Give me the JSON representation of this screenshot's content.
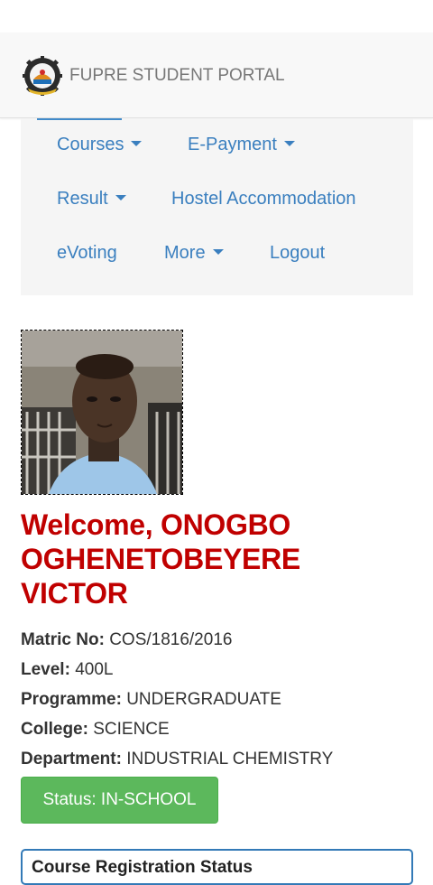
{
  "brand": {
    "title": "FUPRE STUDENT PORTAL",
    "logo_icon": "university-crest-icon"
  },
  "menu": {
    "items": [
      {
        "label": "Courses",
        "has_dropdown": true
      },
      {
        "label": "E-Payment",
        "has_dropdown": true
      },
      {
        "label": "Result",
        "has_dropdown": true
      },
      {
        "label": "Hostel Accommodation",
        "has_dropdown": false
      },
      {
        "label": "eVoting",
        "has_dropdown": false
      },
      {
        "label": "More",
        "has_dropdown": true
      },
      {
        "label": "Logout",
        "has_dropdown": false
      }
    ]
  },
  "profile": {
    "welcome_prefix": "Welcome,",
    "name_lines": [
      "ONOGBO",
      "OGHENETOBEYERE",
      "VICTOR"
    ],
    "fields": [
      {
        "label": "Matric No:",
        "value": "COS/1816/2016"
      },
      {
        "label": "Level:",
        "value": "400L"
      },
      {
        "label": "Programme:",
        "value": "UNDERGRADUATE"
      },
      {
        "label": "College:",
        "value": "SCIENCE"
      },
      {
        "label": "Department:",
        "value": "INDUSTRIAL CHEMISTRY"
      }
    ],
    "status_label": "Status: IN-SCHOOL"
  },
  "panel": {
    "heading": "Course Registration Status"
  },
  "colors": {
    "accent": "#3a7fbf",
    "welcome": "#c00000",
    "status": "#5cb85c",
    "panel_border": "#337ab7"
  }
}
